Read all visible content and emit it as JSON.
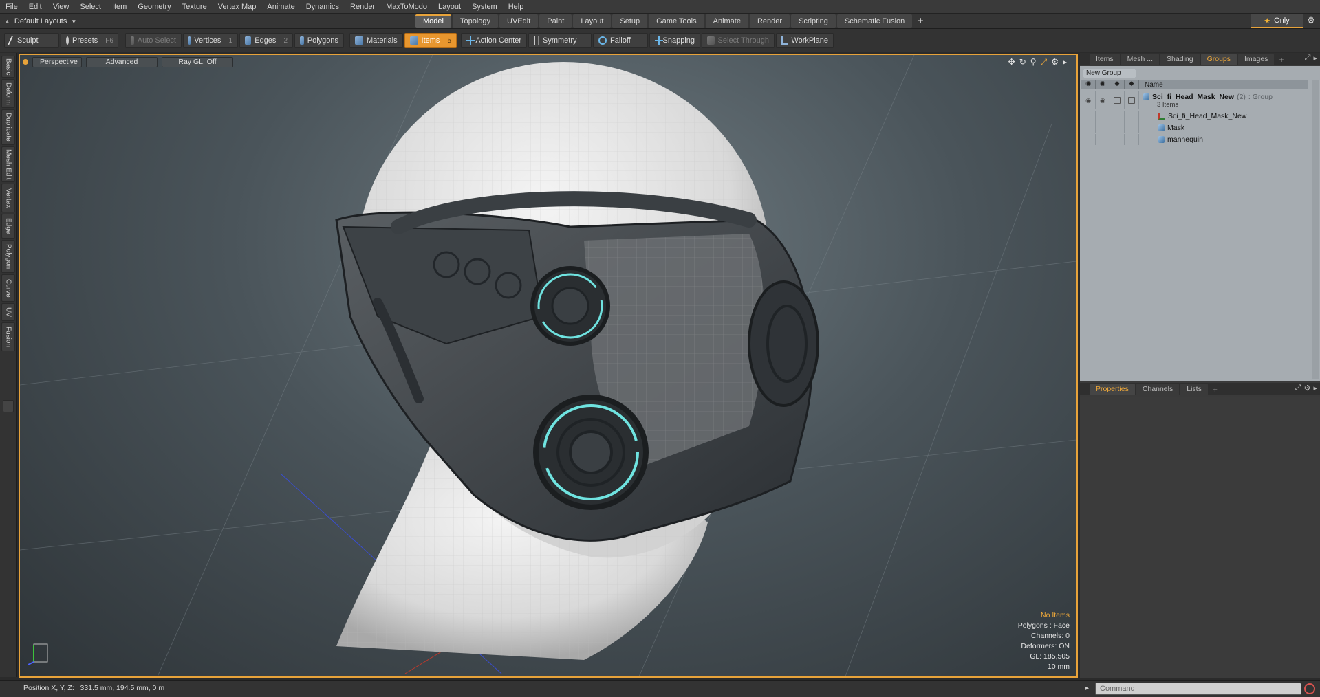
{
  "menu": [
    "File",
    "Edit",
    "View",
    "Select",
    "Item",
    "Geometry",
    "Texture",
    "Vertex Map",
    "Animate",
    "Dynamics",
    "Render",
    "MaxToModo",
    "Layout",
    "System",
    "Help"
  ],
  "layout_switch": "Default Layouts",
  "layout_tabs": [
    "Model",
    "Topology",
    "UVEdit",
    "Paint",
    "Layout",
    "Setup",
    "Game Tools",
    "Animate",
    "Render",
    "Scripting",
    "Schematic Fusion"
  ],
  "active_layout_tab": "Model",
  "only_label": "Only",
  "toolbar": {
    "sculpt": "Sculpt",
    "presets": "Presets",
    "presets_key": "F6",
    "auto_select": "Auto Select",
    "vertices": "Vertices",
    "vertices_key": "1",
    "edges": "Edges",
    "edges_key": "2",
    "polygons": "Polygons",
    "materials": "Materials",
    "items": "Items",
    "items_key": "5",
    "action_center": "Action Center",
    "symmetry": "Symmetry",
    "falloff": "Falloff",
    "snapping": "Snapping",
    "select_through": "Select Through",
    "workplane": "WorkPlane"
  },
  "left_tabs": [
    "Basic",
    "Deform",
    "Duplicate",
    "Mesh Edit",
    "Vertex",
    "Edge",
    "Polygon",
    "Curve",
    "UV",
    "Fusion"
  ],
  "viewport": {
    "view": "Perspective",
    "shading": "Advanced",
    "raygl": "Ray GL: Off",
    "info": {
      "items": "No Items",
      "polygons": "Polygons : Face",
      "channels": "Channels: 0",
      "deformers": "Deformers: ON",
      "gl": "GL: 185,505",
      "scale": "10 mm"
    }
  },
  "status": {
    "position_label": "Position X, Y, Z:",
    "position_value": "331.5 mm, 194.5 mm, 0 m"
  },
  "command": {
    "placeholder": "Command"
  },
  "right_panel": {
    "top_tabs": [
      "Items",
      "Mesh ...",
      "Shading",
      "Groups",
      "Images"
    ],
    "active_top_tab": "Groups",
    "new_group": "New Group",
    "name_header": "Name",
    "group": {
      "name": "Sci_fi_Head_Mask_New",
      "count": "(2)",
      "type": ": Group",
      "items_count": "3 Items"
    },
    "children": [
      "Sci_fi_Head_Mask_New",
      "Mask",
      "mannequin"
    ],
    "bottom_tabs": [
      "Properties",
      "Channels",
      "Lists"
    ],
    "active_bottom_tab": "Properties"
  },
  "colors": {
    "accent": "#e8a33a",
    "viewport_bg": "#4a545a",
    "groups_bg": "#a6acb1",
    "mask_glow": "#6fe3e0"
  },
  "icons": {
    "star": "star-icon",
    "gear": "gear-icon",
    "eye": "eye-icon",
    "lock": "lock-icon"
  }
}
